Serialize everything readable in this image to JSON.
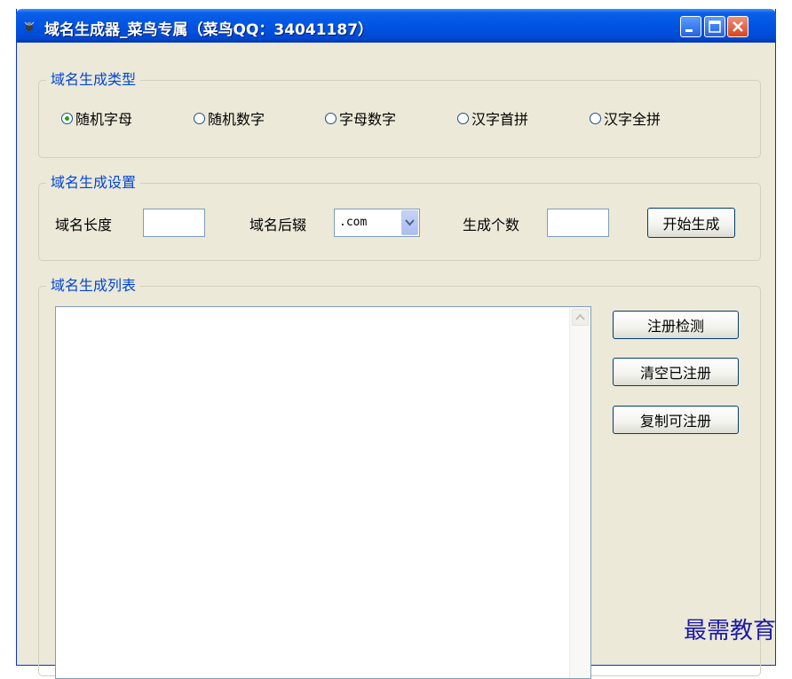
{
  "window": {
    "title": "域名生成器_菜鸟专属（菜鸟QQ：34041187）"
  },
  "group_type": {
    "label": "域名生成类型",
    "options": [
      {
        "label": "随机字母",
        "checked": true
      },
      {
        "label": "随机数字",
        "checked": false
      },
      {
        "label": "字母数字",
        "checked": false
      },
      {
        "label": "汉字首拼",
        "checked": false
      },
      {
        "label": "汉字全拼",
        "checked": false
      }
    ]
  },
  "group_settings": {
    "label": "域名生成设置",
    "length_label": "域名长度",
    "length_value": "",
    "suffix_label": "域名后辍",
    "suffix_value": ".com",
    "count_label": "生成个数",
    "count_value": "",
    "start_button": "开始生成"
  },
  "group_list": {
    "label": "域名生成列表",
    "check_button": "注册检测",
    "clear_button": "清空已注册",
    "copy_button": "复制可注册"
  },
  "watermark": "最需教育"
}
